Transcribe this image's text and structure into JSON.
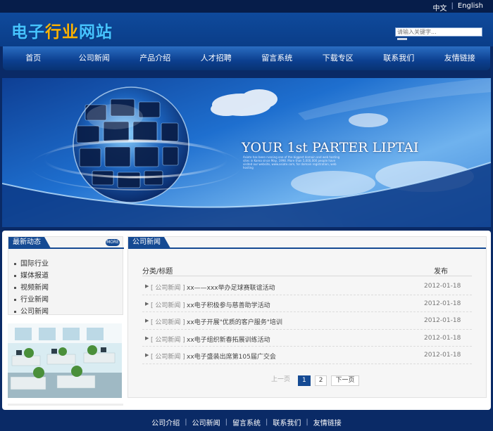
{
  "lang": {
    "cn": "中文",
    "en": "English",
    "sep": "|"
  },
  "logo": {
    "part1": "电子",
    "part2": "行业",
    "part3": "网站"
  },
  "search": {
    "placeholder": "请输入关键字..."
  },
  "nav": [
    "首页",
    "公司新闻",
    "产品介绍",
    "人才招聘",
    "留言系统",
    "下载专区",
    "联系我们",
    "友情链接"
  ],
  "banner": {
    "title": "YOUR 1st PARTER LIPTAI",
    "subtitle": "Asiate has been running one of the biggest domain and web hosting sites in Korea since May, 1998. More than 5,000,000 people have visited our website, www.asiate.com, for domain registration, web hosting"
  },
  "sidebar": {
    "title": "最新动态",
    "more": "MORE",
    "categories": [
      "国际行业",
      "媒体报道",
      "视频新闻",
      "行业新闻",
      "公司新闻"
    ]
  },
  "main": {
    "title": "公司新闻",
    "col_title": "分类/标题",
    "col_date": "发布",
    "rows": [
      {
        "cat": "[ 公司新闻 ]",
        "title": "xx——xxx举办足球赛联谊活动",
        "date": "2012-01-18"
      },
      {
        "cat": "[ 公司新闻 ]",
        "title": "xx电子积极参与慈善助学活动",
        "date": "2012-01-18"
      },
      {
        "cat": "[ 公司新闻 ]",
        "title": "xx电子开展\"优质的客户服务\"培训",
        "date": "2012-01-18"
      },
      {
        "cat": "[ 公司新闻 ]",
        "title": "xx电子组织新春拓展训练活动",
        "date": "2012-01-18"
      },
      {
        "cat": "[ 公司新闻 ]",
        "title": "xx电子盛装出席第105届广交会",
        "date": "2012-01-18"
      }
    ],
    "pager": {
      "prev": "上一页",
      "p1": "1",
      "p2": "2",
      "next": "下一页"
    }
  },
  "footer": {
    "links": [
      "公司介绍",
      "公司新闻",
      "留言系统",
      "联系我们",
      "友情链接"
    ],
    "sep": "|"
  },
  "colors": {
    "brand": "#154a93",
    "dark": "#0a2a66",
    "logo_blue": "#46c3ff",
    "logo_orange": "#ffb300"
  }
}
